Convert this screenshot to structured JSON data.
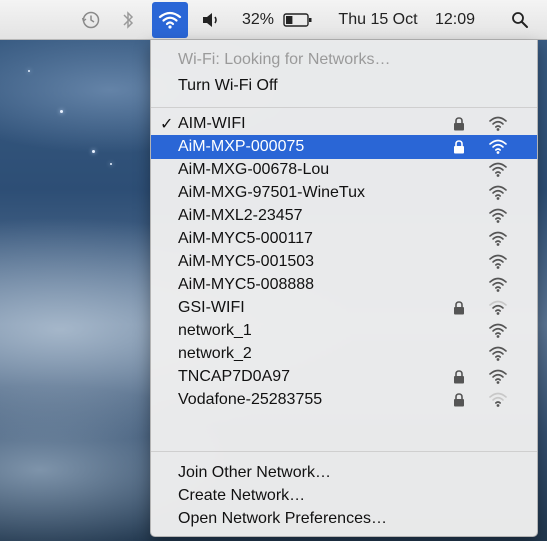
{
  "menubar": {
    "time_machine_icon": "time-machine-icon",
    "bluetooth_icon": "bluetooth-icon",
    "wifi_icon": "wifi-icon",
    "volume_icon": "volume-icon",
    "battery_percent": "32%",
    "battery_level": 0.32,
    "date": "Thu 15 Oct",
    "time": "12:09",
    "spotlight_icon": "search-icon"
  },
  "wifi_menu": {
    "status": "Wi-Fi: Looking for Networks…",
    "toggle": "Turn Wi-Fi Off",
    "networks": [
      {
        "name": "AIM-WIFI",
        "connected": true,
        "locked": true,
        "signal": 3
      },
      {
        "name": "AiM-MXP-000075",
        "connected": false,
        "locked": true,
        "signal": 3,
        "highlighted": true
      },
      {
        "name": "AiM-MXG-00678-Lou",
        "connected": false,
        "locked": false,
        "signal": 3
      },
      {
        "name": "AiM-MXG-97501-WineTux",
        "connected": false,
        "locked": false,
        "signal": 3
      },
      {
        "name": "AiM-MXL2-23457",
        "connected": false,
        "locked": false,
        "signal": 3
      },
      {
        "name": "AiM-MYC5-000117",
        "connected": false,
        "locked": false,
        "signal": 3
      },
      {
        "name": "AiM-MYC5-001503",
        "connected": false,
        "locked": false,
        "signal": 3
      },
      {
        "name": "AiM-MYC5-008888",
        "connected": false,
        "locked": false,
        "signal": 3
      },
      {
        "name": "GSI-WIFI",
        "connected": false,
        "locked": true,
        "signal": 2
      },
      {
        "name": "network_1",
        "connected": false,
        "locked": false,
        "signal": 3
      },
      {
        "name": "network_2",
        "connected": false,
        "locked": false,
        "signal": 3
      },
      {
        "name": "TNCAP7D0A97",
        "connected": false,
        "locked": true,
        "signal": 3
      },
      {
        "name": "Vodafone-25283755",
        "connected": false,
        "locked": true,
        "signal": 1
      }
    ],
    "checkmark": "✓",
    "actions": {
      "join_other": "Join Other Network…",
      "create": "Create Network…",
      "preferences": "Open Network Preferences…"
    }
  },
  "colors": {
    "highlight": "#2a66d6",
    "menu_bg": "#eeeeee",
    "disabled_text": "#9a9a9a"
  }
}
